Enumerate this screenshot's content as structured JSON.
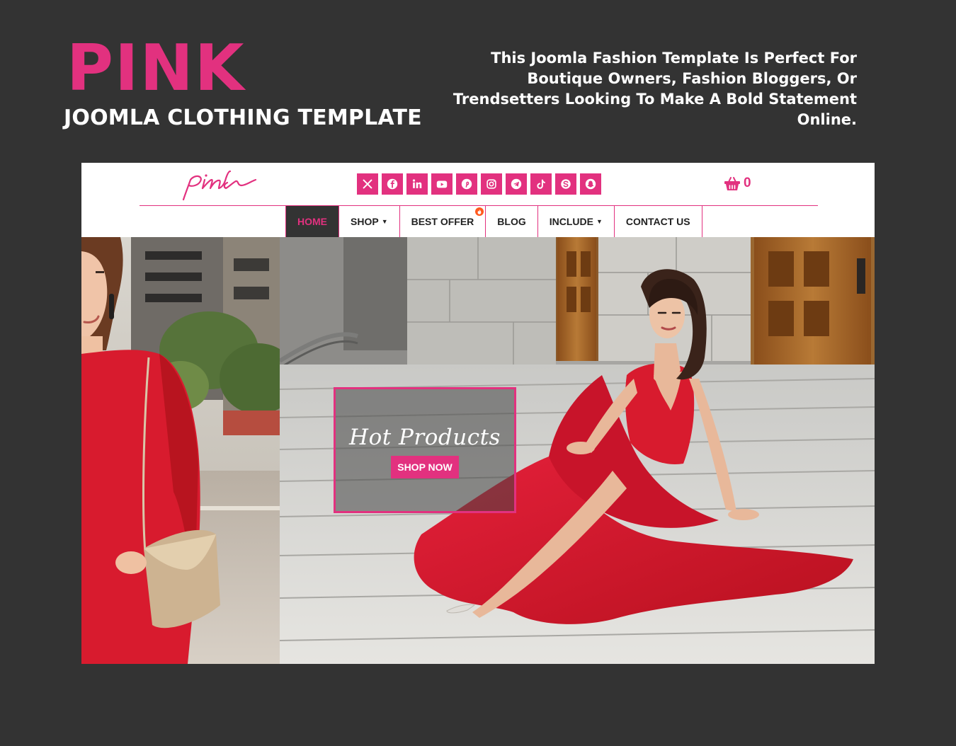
{
  "promo": {
    "title": "PINK",
    "subtitle": "JOOMLA CLOTHING TEMPLATE",
    "description": "This Joomla Fashion Template Is Perfect For Boutique Owners, Fashion Bloggers, Or Trendsetters Looking To Make A Bold Statement Online."
  },
  "site": {
    "logo_text": "pink",
    "social_icons": [
      "x-icon",
      "facebook-icon",
      "linkedin-icon",
      "youtube-icon",
      "pinterest-icon",
      "instagram-icon",
      "telegram-icon",
      "tiktok-icon",
      "skype-icon",
      "snapchat-icon"
    ],
    "cart_count": "0",
    "nav": {
      "home": "HOME",
      "shop": "SHOP",
      "best_offer": "BEST OFFER",
      "blog": "BLOG",
      "include": "INCLUDE",
      "contact": "CONTACT US"
    },
    "hero": {
      "heading": "Hot Products",
      "button": "SHOP NOW"
    }
  },
  "colors": {
    "accent": "#e2317f",
    "background": "#333333",
    "nav_active_bg": "#333333",
    "dress_red": "#d81b2e"
  }
}
